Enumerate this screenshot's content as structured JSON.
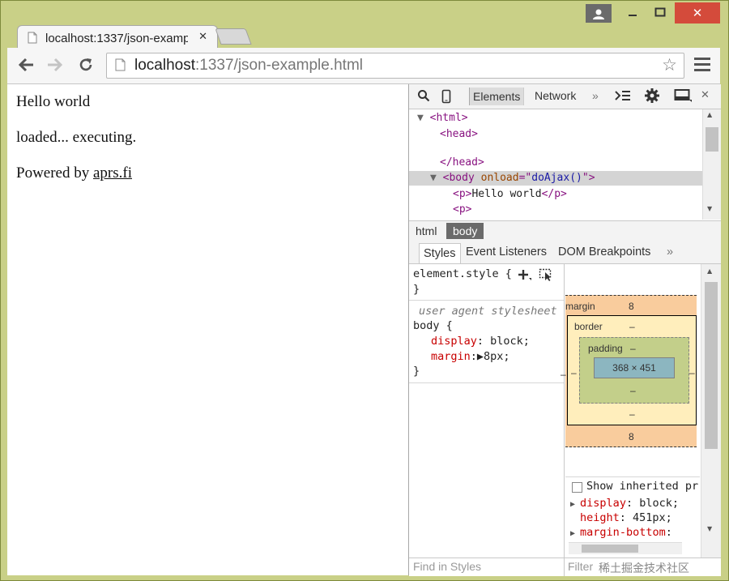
{
  "tab": {
    "title": "localhost:1337/json-examp"
  },
  "address": {
    "host": "localhost",
    "path": ":1337/json-example.html"
  },
  "page": {
    "line1": "Hello world",
    "line2": "loaded... executing.",
    "powered_prefix": "Powered by ",
    "link": "aprs.fi"
  },
  "devtools": {
    "tabs": {
      "elements": "Elements",
      "network": "Network",
      "more": "»"
    },
    "dom": {
      "l1": "<html>",
      "l2": "<head>",
      "l3": "</head>",
      "l4_tag": "<body ",
      "l4_attr": "onload",
      "l4_eq": "=\"",
      "l4_val": "doAjax()",
      "l4_end": "\">",
      "l5_open": "<p>",
      "l5_text": "Hello world",
      "l5_close": "</p>",
      "l6": "<p>"
    },
    "breadcrumbs": [
      "html",
      "body"
    ],
    "subtabs": {
      "styles": "Styles",
      "event_listeners": "Event Listeners",
      "dom_breakpoints": "DOM Breakpoints",
      "more": "»"
    },
    "styles": {
      "element_style": "element.style {",
      "element_close": "}",
      "ua_label": "user agent stylesheet",
      "selector": "body {",
      "p1_name": "display",
      "p1_val": ": block;",
      "p2_name": "margin",
      "p2_val": ":▶8px;",
      "close": "}"
    },
    "box_model": {
      "margin_label": "margin",
      "margin_top": "8",
      "margin_bottom": "8",
      "margin_left": "–",
      "margin_right": "–",
      "border_label": "border",
      "border_top": "–",
      "border_bottom": "–",
      "border_left": "–",
      "border_right": "–",
      "padding_label": "padding",
      "padding_top": "–",
      "padding_bottom": "–",
      "content": "368 × 451"
    },
    "computed": {
      "show_inherited": "Show inherited pr",
      "c1_name": "display",
      "c1_val": ": block;",
      "c2_name": "height",
      "c2_val": ": 451px;",
      "c3_name": "margin-bottom",
      "c3_val": ":"
    },
    "find_placeholder": "Find in Styles",
    "filter_placeholder": "Filter"
  },
  "watermark": "稀土掘金技术社区"
}
